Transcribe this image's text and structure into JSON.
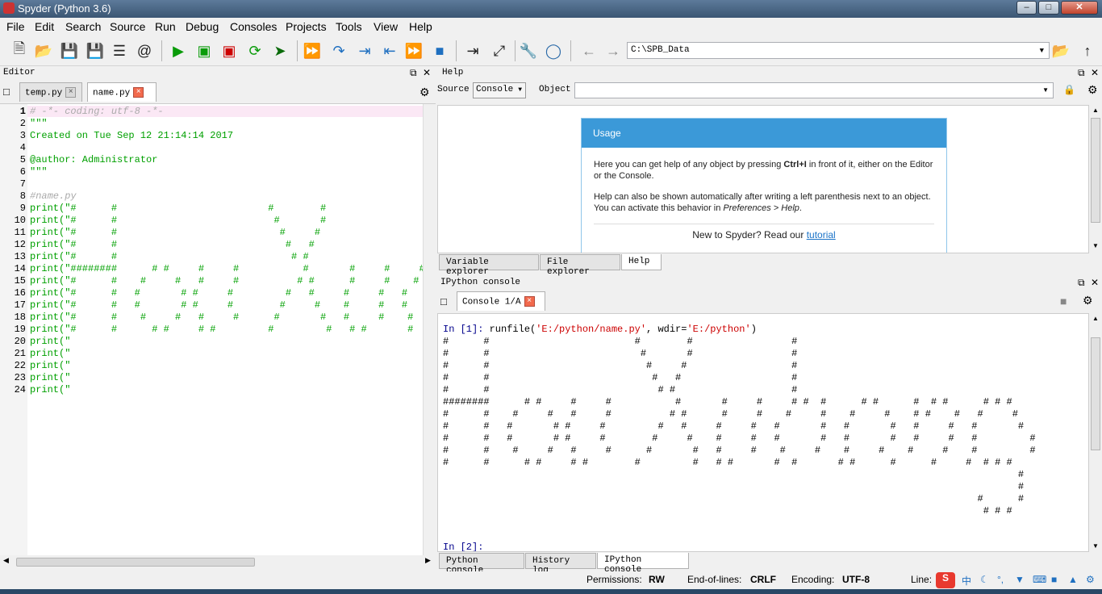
{
  "window": {
    "title": "Spyder (Python 3.6)"
  },
  "menu": [
    "File",
    "Edit",
    "Search",
    "Source",
    "Run",
    "Debug",
    "Consoles",
    "Projects",
    "Tools",
    "View",
    "Help"
  ],
  "toolbar": {
    "path": "C:\\SPB_Data",
    "icons": [
      "new-file-icon",
      "open-file-icon",
      "save-icon",
      "save-all-icon",
      "list-icon",
      "at-icon",
      "run-icon",
      "run-cell-icon",
      "run-cell-advance-icon",
      "rerun-icon",
      "run-selection-icon",
      "debug-icon",
      "step-icon",
      "step-into-icon",
      "step-return-icon",
      "continue-icon",
      "stop-icon",
      "maximize-pane-icon",
      "fullscreen-icon",
      "preferences-icon",
      "python-path-icon",
      "back-icon",
      "forward-icon",
      "browse-folder-icon",
      "parent-dir-icon"
    ]
  },
  "editor": {
    "title": "Editor",
    "tabs": [
      "temp.py",
      "name.py"
    ],
    "line_numbers": [
      "1",
      "2",
      "3",
      "4",
      "5",
      "6",
      "7",
      "8",
      "9",
      "10",
      "11",
      "12",
      "13",
      "14",
      "15",
      "16",
      "17",
      "18",
      "19",
      "20",
      "21",
      "22",
      "23",
      "24"
    ],
    "lines": [
      "# -*- coding: utf-8 -*-",
      "\"\"\"",
      "Created on Tue Sep 12 21:14:14 2017",
      "",
      "@author: Administrator",
      "\"\"\"",
      "",
      "#name.py",
      "print(\"#      #                          #        #",
      "print(\"#      #                           #       #",
      "print(\"#      #                            #     #",
      "print(\"#      #                             #   #",
      "print(\"#      #                              # #",
      "print(\"########      # #     #     #           #       #     #     #",
      "print(\"#      #    #     #   #     #          # #      #     #    #",
      "print(\"#      #   #       # #     #         #   #     #     #   #",
      "print(\"#      #   #       # #     #        #     #    #     #   #",
      "print(\"#      #    #     #   #     #      #       #   #     #    #",
      "print(\"#      #      # #     # #         #         #   # #       #",
      "print(\"",
      "print(\"",
      "print(\"",
      "print(\"",
      "print(\""
    ]
  },
  "help": {
    "title": "Help",
    "source_label": "Source",
    "source_value": "Console",
    "object_label": "Object",
    "usage_title": "Usage",
    "p1_a": "Here you can get help of any object by pressing ",
    "p1_b": "Ctrl+I",
    "p1_c": " in front of it, either on the Editor or the Console.",
    "p2_a": "Help can also be shown automatically after writing a left parenthesis next to an object. You can activate this behavior in ",
    "p2_b": "Preferences > Help",
    "p2_c": ".",
    "new_a": "New to Spyder? Read our ",
    "new_link": "tutorial",
    "tabs": [
      "Variable explorer",
      "File explorer",
      "Help"
    ]
  },
  "console": {
    "title": "IPython console",
    "tab": "Console 1/A",
    "in1_prompt": "In [1]: ",
    "in1_cmd_a": "runfile(",
    "in1_arg1": "'E:/python/name.py'",
    "in1_cmd_b": ", wdir=",
    "in1_arg2": "'E:/python'",
    "in1_cmd_c": ")",
    "output": [
      "#      #                         #        #                 #",
      "#      #                          #       #                 #",
      "#      #                           #     #                  #",
      "#      #                            #   #                   #",
      "#      #                             # #                    #",
      "########      # #     #     #           #       #     #     # #  #      # #      #  # #      # # #",
      "#      #    #     #   #     #          # #      #     #    #     #    #     #    # #    #   #     #",
      "#      #   #       # #     #         #   #     #     #   #       #   #       #   #     #   #       #",
      "#      #   #       # #     #        #     #    #     #   #       #   #       #   #     #   #         #",
      "#      #    #     #   #     #      #       #   #     #    #     #    #     #    #     #    #         #",
      "#      #      # #     # #        #         #   # #       #  #       # #      #      #     #  # # #",
      "                                                                                                   #",
      "                                                                                                   #",
      "                                                                                            #      #",
      "                                                                                             # # #"
    ],
    "in2_prompt": "In [2]:",
    "tabs": [
      "Python console",
      "History log",
      "IPython console"
    ]
  },
  "status": {
    "permissions_label": "Permissions:",
    "permissions": "RW",
    "eol_label": "End-of-lines:",
    "eol": "CRLF",
    "encoding_label": "Encoding:",
    "encoding": "UTF-8",
    "line_label": "Line:",
    "ime": "中"
  }
}
